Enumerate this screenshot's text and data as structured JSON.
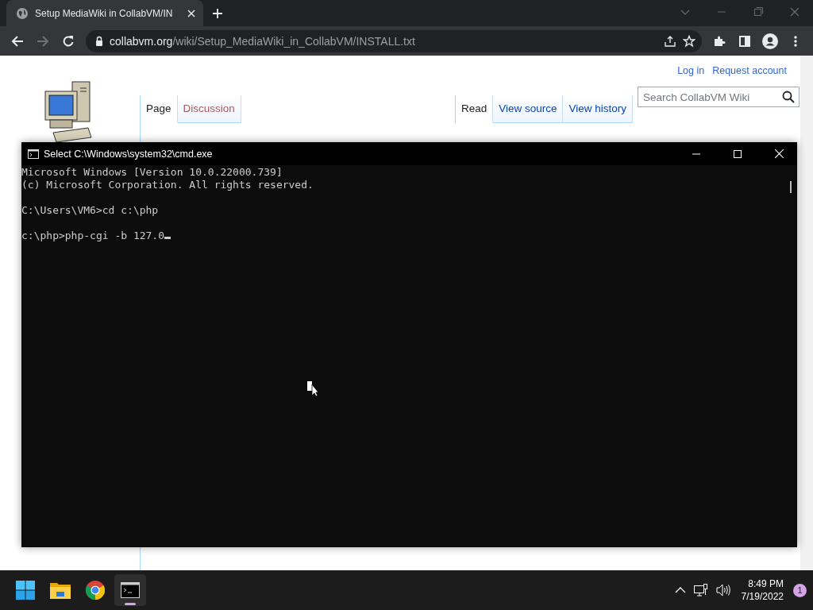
{
  "browser": {
    "tab": {
      "title": "Setup MediaWiki in CollabVM/IN",
      "selected": true
    },
    "url_host": "collabvm.org",
    "url_path": "/wiki/Setup_MediaWiki_in_CollabVM/INSTALL.txt"
  },
  "wiki": {
    "personal_links": [
      "Log in",
      "Request account"
    ],
    "left_tabs": [
      {
        "label": "Page",
        "selected": true
      },
      {
        "label": "Discussion",
        "selected": false
      }
    ],
    "right_tabs": [
      {
        "label": "Read",
        "selected": true
      },
      {
        "label": "View source",
        "selected": false
      },
      {
        "label": "View history",
        "selected": false
      }
    ],
    "search": {
      "placeholder": "Search CollabVM Wiki"
    }
  },
  "console": {
    "title": "Select C:\\Windows\\system32\\cmd.exe",
    "paragraphs": [
      [
        "Microsoft Windows [Version 10.0.22000.739]",
        "(c) Microsoft Corporation. All rights reserved."
      ],
      [
        "C:\\Users\\VM6>cd c:\\php"
      ],
      [
        "c:\\php>php-cgi -b 127.0"
      ]
    ]
  },
  "taskbar": {
    "apps": [
      {
        "kind": "start",
        "selected": false
      },
      {
        "kind": "files",
        "selected": false
      },
      {
        "kind": "browser",
        "selected": false
      },
      {
        "kind": "terminal",
        "selected": true
      }
    ],
    "time": "8:49 PM",
    "date": "7/19/2022",
    "notification_count": "1"
  }
}
